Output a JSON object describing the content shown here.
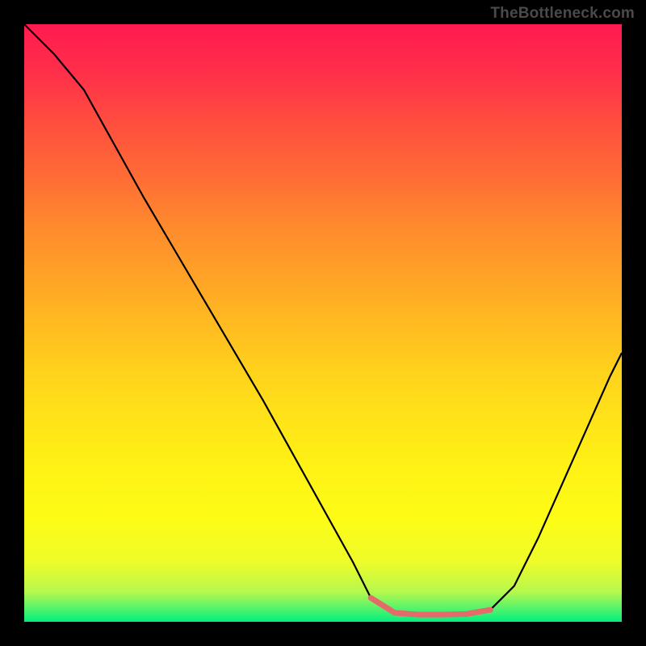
{
  "watermark": "TheBottleneck.com",
  "chart_data": {
    "type": "line",
    "title": "",
    "xlabel": "",
    "ylabel": "",
    "xlim": [
      0,
      100
    ],
    "ylim": [
      0,
      100
    ],
    "grid": false,
    "legend": false,
    "background": "rainbow-gradient-vertical",
    "series": [
      {
        "name": "bottleneck-curve",
        "color": "#000000",
        "x": [
          0,
          5,
          10,
          15,
          20,
          25,
          30,
          35,
          40,
          45,
          50,
          55,
          58,
          62,
          66,
          70,
          74,
          78,
          82,
          86,
          90,
          94,
          98,
          100
        ],
        "y": [
          100,
          95,
          89,
          80,
          71,
          62.5,
          54,
          45.5,
          37,
          28,
          19,
          10,
          4,
          1.5,
          1.2,
          1.2,
          1.3,
          2,
          6,
          14,
          23,
          32,
          41,
          45
        ]
      },
      {
        "name": "optimal-range-highlight",
        "color": "#e56a6a",
        "x": [
          58,
          62,
          66,
          70,
          74,
          78
        ],
        "y": [
          4,
          1.5,
          1.2,
          1.2,
          1.3,
          2
        ]
      }
    ],
    "optimal_range": {
      "x_start": 58,
      "x_end": 78
    }
  },
  "colors": {
    "page_bg": "#000000",
    "watermark": "#4a4a4a",
    "curve": "#000000",
    "highlight": "#e56a6a"
  }
}
